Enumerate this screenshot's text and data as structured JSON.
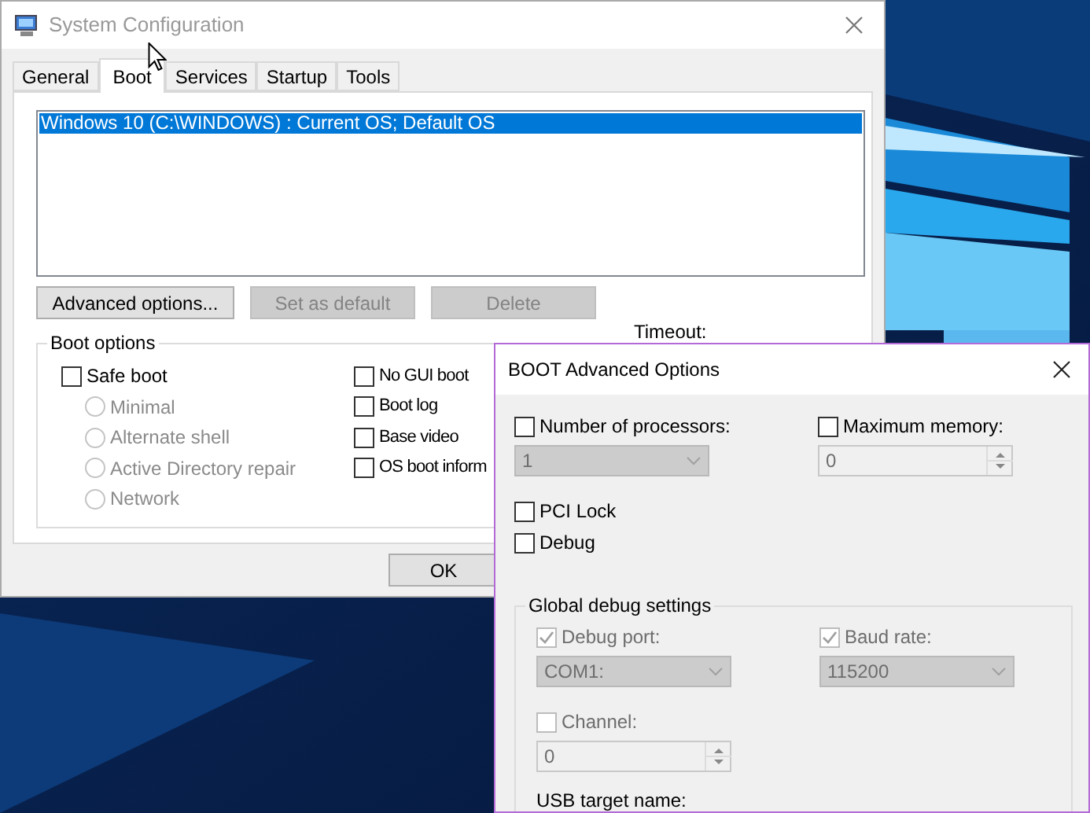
{
  "main_window": {
    "title": "System Configuration",
    "tabs": [
      {
        "label": "General",
        "selected": false
      },
      {
        "label": "Boot",
        "selected": true
      },
      {
        "label": "Services",
        "selected": false
      },
      {
        "label": "Startup",
        "selected": false
      },
      {
        "label": "Tools",
        "selected": false
      }
    ],
    "boot_entries": [
      {
        "label": "Windows 10 (C:\\WINDOWS) : Current OS; Default OS",
        "selected": true
      }
    ],
    "buttons": [
      {
        "label": "Advanced options...",
        "disabled": false
      },
      {
        "label": "Set as default",
        "disabled": true
      },
      {
        "label": "Delete",
        "disabled": true
      }
    ],
    "boot_options": {
      "title": "Boot options",
      "safe_boot": {
        "label": "Safe boot",
        "checked": false
      },
      "safe_boot_modes": [
        {
          "label": "Minimal",
          "selected": false,
          "disabled": true
        },
        {
          "label": "Alternate shell",
          "selected": false,
          "disabled": true
        },
        {
          "label": "Active Directory repair",
          "selected": false,
          "disabled": true
        },
        {
          "label": "Network",
          "selected": false,
          "disabled": true
        }
      ],
      "flags": [
        {
          "label": "No GUI boot",
          "checked": false
        },
        {
          "label": "Boot log",
          "checked": false
        },
        {
          "label": "Base video",
          "checked": false
        },
        {
          "label": "OS boot inform",
          "checked": false
        }
      ]
    },
    "timeout_label": "Timeout:",
    "ok_button": "OK"
  },
  "advanced_dialog": {
    "title": "BOOT Advanced Options",
    "processors": {
      "label": "Number of processors:",
      "checked": false,
      "value": "1",
      "disabled": true
    },
    "maximum_memory": {
      "label": "Maximum memory:",
      "checked": false,
      "value": "0",
      "disabled": true
    },
    "pci_lock": {
      "label": "PCI Lock",
      "checked": false
    },
    "debug": {
      "label": "Debug",
      "checked": false
    },
    "global_debug": {
      "title": "Global debug settings",
      "debug_port": {
        "label": "Debug port:",
        "checked": true,
        "disabled": true,
        "value": "COM1:"
      },
      "baud_rate": {
        "label": "Baud rate:",
        "checked": true,
        "disabled": true,
        "value": "115200"
      },
      "channel": {
        "label": "Channel:",
        "checked": false,
        "disabled": true,
        "value": "0"
      },
      "usb_target_label": "USB target name:"
    }
  }
}
